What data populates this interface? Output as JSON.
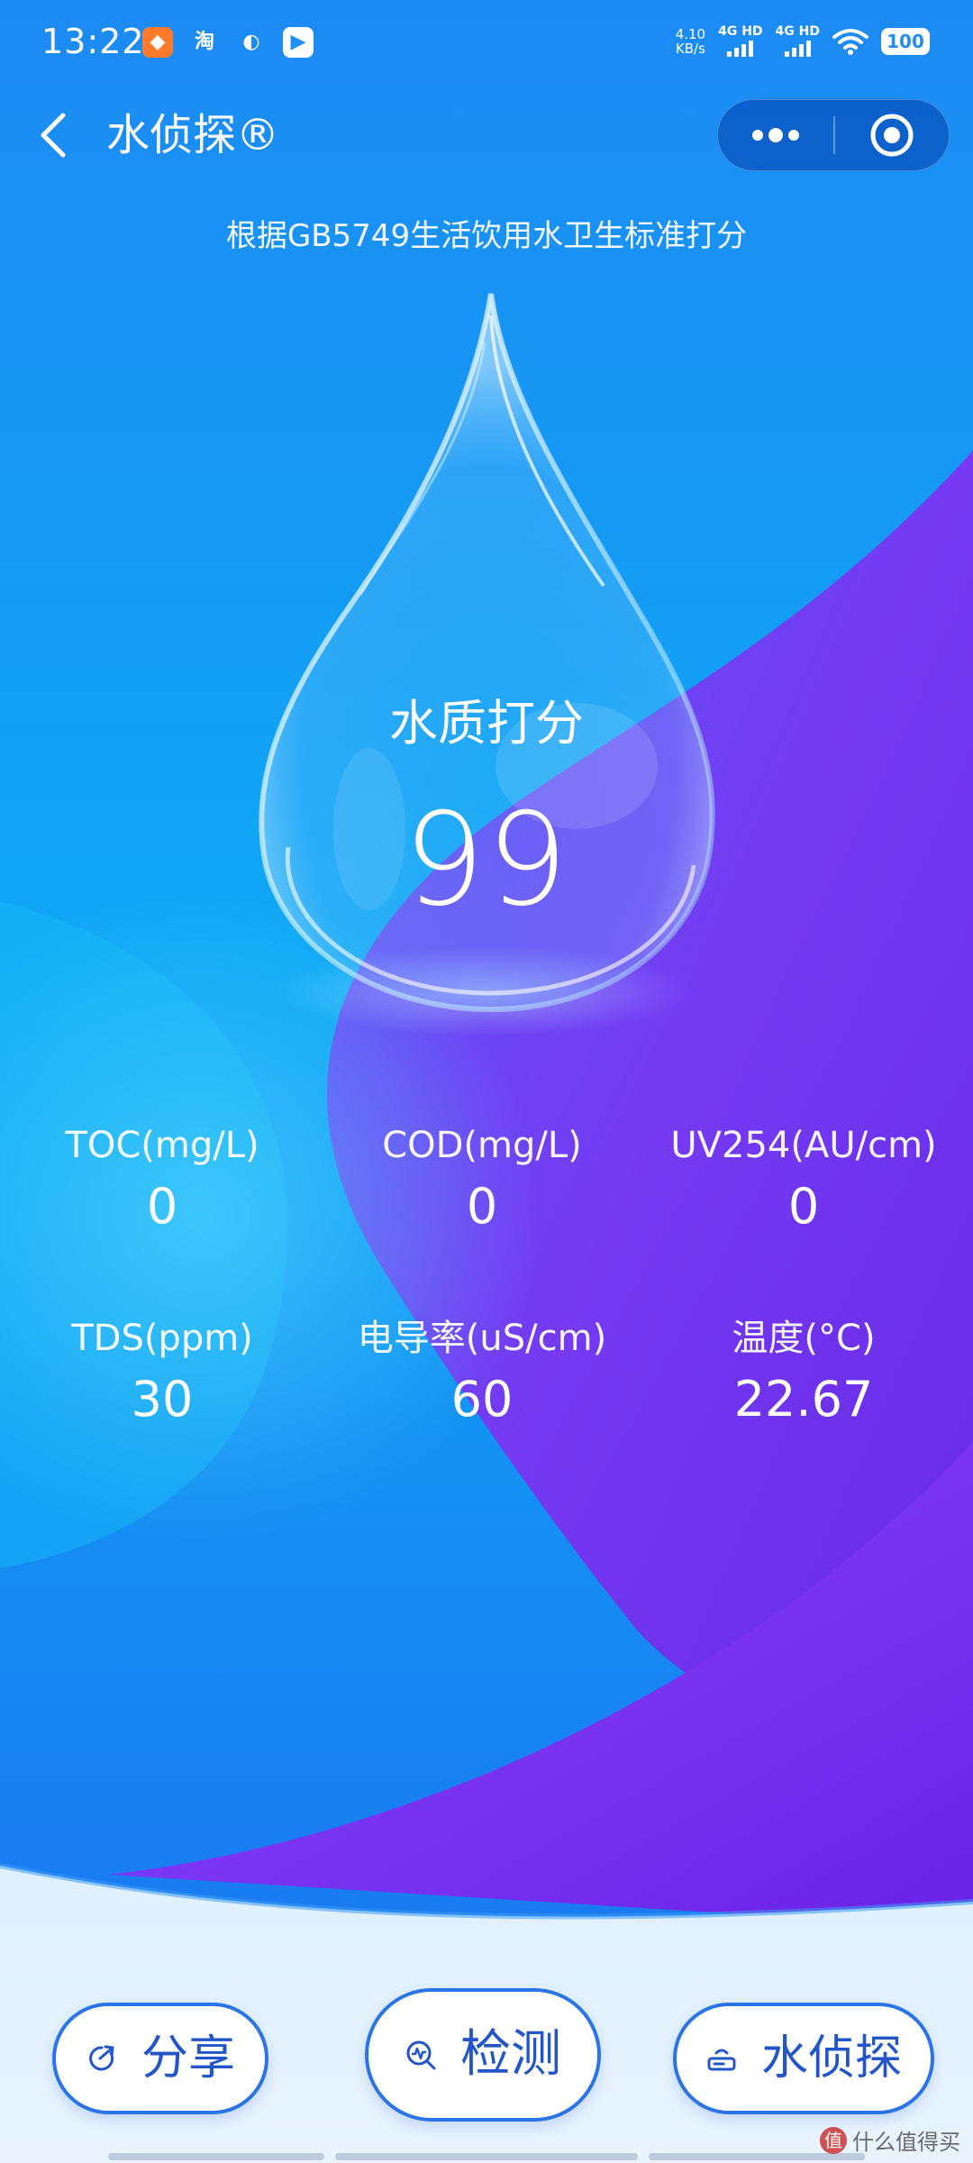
{
  "status_bar": {
    "time": "13:22",
    "app_icons": [
      "notification-app-icon",
      "taobao-icon",
      "browser-icon",
      "video-app-icon"
    ],
    "taobao_label": "淘",
    "net_speed_value": "4.10",
    "net_speed_unit": "KB/s",
    "signal_1_label": "4G HD",
    "signal_2_label": "4G HD",
    "battery": "100"
  },
  "nav": {
    "title": "水侦探®"
  },
  "subtitle": "根据GB5749生活饮用水卫生标准打分",
  "score": {
    "label": "水质打分",
    "value": "99"
  },
  "metrics": [
    {
      "label": "TOC(mg/L)",
      "value": "0"
    },
    {
      "label": "COD(mg/L)",
      "value": "0"
    },
    {
      "label": "UV254(AU/cm)",
      "value": "0"
    },
    {
      "label": "TDS(ppm)",
      "value": "30"
    },
    {
      "label": "电导率(uS/cm)",
      "value": "60"
    },
    {
      "label": "温度(°C)",
      "value": "22.67"
    }
  ],
  "buttons": {
    "share": "分享",
    "detect": "检测",
    "brand": "水侦探"
  },
  "watermark": {
    "badge": "值",
    "text": "什么值得买"
  },
  "colors": {
    "background_top": "#1e8ff5",
    "background_purple": "#7a2bf0",
    "button_text": "#2255c9",
    "button_border": "#2a74e8"
  }
}
